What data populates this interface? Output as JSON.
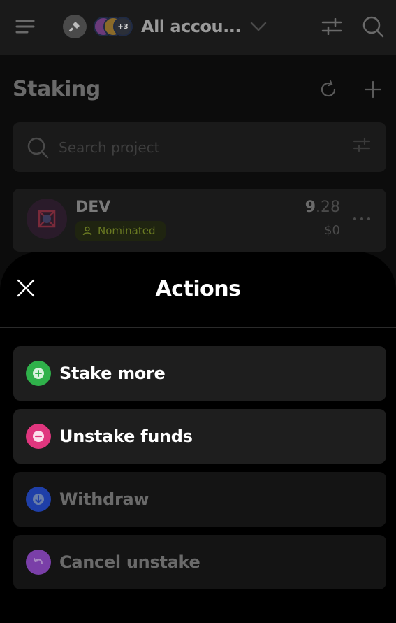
{
  "header": {
    "account_label": "All accou...",
    "accounts_more": "+3"
  },
  "page": {
    "title": "Staking",
    "search_placeholder": "Search project"
  },
  "pool": {
    "name": "DEV",
    "status": "Nominated",
    "amount_int": "9",
    "amount_dec": ".28",
    "fiat": "$0"
  },
  "sheet": {
    "title": "Actions",
    "actions": [
      {
        "label": "Stake more",
        "icon": "plus-circle-icon",
        "color": "#2fb14a",
        "enabled": true
      },
      {
        "label": "Unstake funds",
        "icon": "minus-circle-icon",
        "color": "#e0367e",
        "enabled": true
      },
      {
        "label": "Withdraw",
        "icon": "arrow-down-circle-icon",
        "color": "#1f3fa8",
        "enabled": false
      },
      {
        "label": "Cancel unstake",
        "icon": "undo-circle-icon",
        "color": "#7a3fa8",
        "enabled": false
      }
    ]
  }
}
